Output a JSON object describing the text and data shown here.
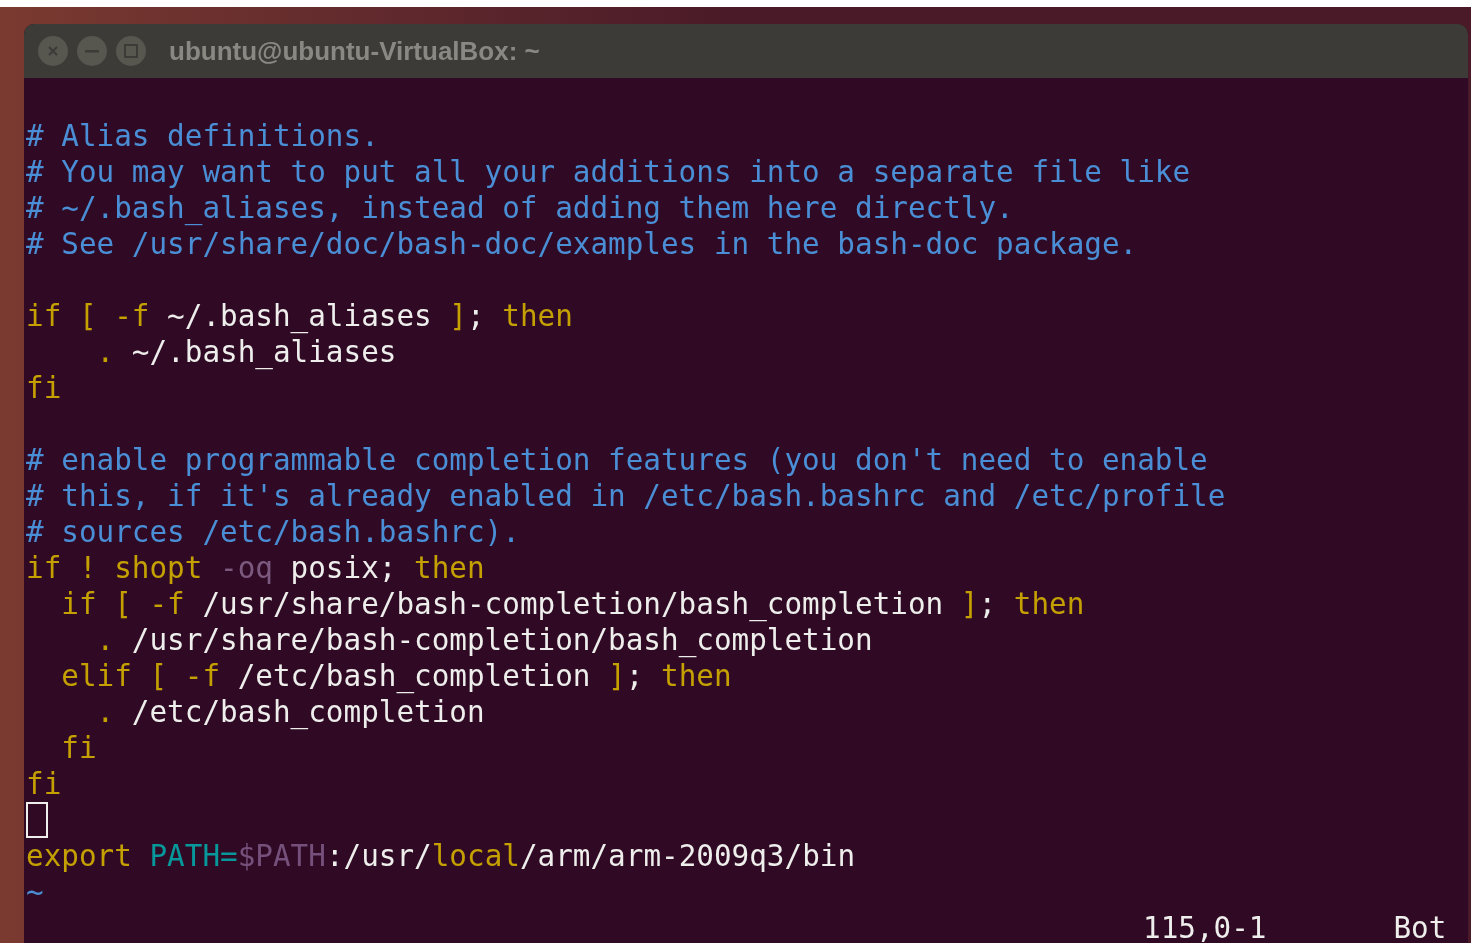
{
  "window": {
    "title": "ubuntu@ubuntu-VirtualBox: ~"
  },
  "editor": {
    "lines": [
      {
        "kind": "code",
        "segments": [
          {
            "kind": "comment",
            "text": "# Alias definitions."
          }
        ]
      },
      {
        "kind": "code",
        "segments": [
          {
            "kind": "comment",
            "text": "# You may want to put all your additions into a separate file like"
          }
        ]
      },
      {
        "kind": "code",
        "segments": [
          {
            "kind": "comment",
            "text": "# ~/.bash_aliases, instead of adding them here directly."
          }
        ]
      },
      {
        "kind": "code",
        "segments": [
          {
            "kind": "comment",
            "text": "# See /usr/share/doc/bash-doc/examples in the bash-doc package."
          }
        ]
      },
      {
        "kind": "blank"
      },
      {
        "kind": "code",
        "segments": [
          {
            "kind": "keyword",
            "text": "if [ -f "
          },
          {
            "kind": "plain",
            "text": "~/.bash_aliases "
          },
          {
            "kind": "keyword",
            "text": "]"
          },
          {
            "kind": "plain",
            "text": "; "
          },
          {
            "kind": "keyword",
            "text": "then"
          }
        ]
      },
      {
        "kind": "code",
        "segments": [
          {
            "kind": "keyword",
            "text": "    . "
          },
          {
            "kind": "plain",
            "text": "~/.bash_aliases"
          }
        ]
      },
      {
        "kind": "code",
        "segments": [
          {
            "kind": "keyword",
            "text": "fi"
          }
        ]
      },
      {
        "kind": "blank"
      },
      {
        "kind": "code",
        "segments": [
          {
            "kind": "comment",
            "text": "# enable programmable completion features (you don't need to enable"
          }
        ]
      },
      {
        "kind": "code",
        "segments": [
          {
            "kind": "comment",
            "text": "# this, if it's already enabled in /etc/bash.bashrc and /etc/profile"
          }
        ]
      },
      {
        "kind": "code",
        "segments": [
          {
            "kind": "comment",
            "text": "# sources /etc/bash.bashrc)."
          }
        ]
      },
      {
        "kind": "code",
        "segments": [
          {
            "kind": "keyword",
            "text": "if ! shopt "
          },
          {
            "kind": "option",
            "text": "-oq"
          },
          {
            "kind": "plain",
            "text": " posix; "
          },
          {
            "kind": "keyword",
            "text": "then"
          }
        ]
      },
      {
        "kind": "code",
        "segments": [
          {
            "kind": "keyword",
            "text": "  if [ -f "
          },
          {
            "kind": "plain",
            "text": "/usr/share/bash-completion/bash_completion "
          },
          {
            "kind": "keyword",
            "text": "]"
          },
          {
            "kind": "plain",
            "text": "; "
          },
          {
            "kind": "keyword",
            "text": "then"
          }
        ]
      },
      {
        "kind": "code",
        "segments": [
          {
            "kind": "keyword",
            "text": "    . "
          },
          {
            "kind": "plain",
            "text": "/usr/share/bash-completion/bash_completion"
          }
        ]
      },
      {
        "kind": "code",
        "segments": [
          {
            "kind": "keyword",
            "text": "  elif [ -f "
          },
          {
            "kind": "plain",
            "text": "/etc/bash_completion "
          },
          {
            "kind": "keyword",
            "text": "]"
          },
          {
            "kind": "plain",
            "text": "; "
          },
          {
            "kind": "keyword",
            "text": "then"
          }
        ]
      },
      {
        "kind": "code",
        "segments": [
          {
            "kind": "keyword",
            "text": "    . "
          },
          {
            "kind": "plain",
            "text": "/etc/bash_completion"
          }
        ]
      },
      {
        "kind": "code",
        "segments": [
          {
            "kind": "keyword",
            "text": "  fi"
          }
        ]
      },
      {
        "kind": "code",
        "segments": [
          {
            "kind": "keyword",
            "text": "fi"
          }
        ]
      },
      {
        "kind": "cursor"
      },
      {
        "kind": "code",
        "segments": [
          {
            "kind": "keyword",
            "text": "export "
          },
          {
            "kind": "identifier",
            "text": "PATH="
          },
          {
            "kind": "variable",
            "text": "$PATH"
          },
          {
            "kind": "plain",
            "text": ":/usr/"
          },
          {
            "kind": "keyword",
            "text": "local"
          },
          {
            "kind": "plain",
            "text": "/arm/arm-2009q3/bin"
          }
        ]
      },
      {
        "kind": "filler",
        "text": "~"
      }
    ],
    "status": {
      "position": "115,0-1",
      "scroll": "Bot"
    }
  }
}
